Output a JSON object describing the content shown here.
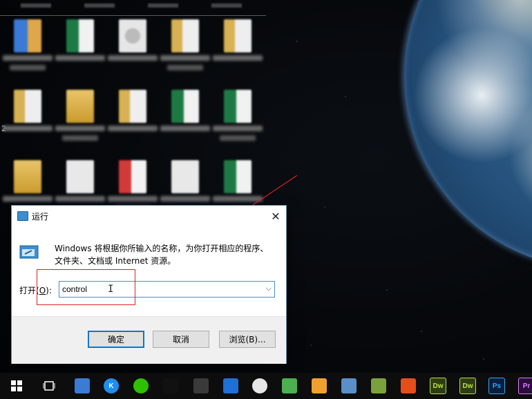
{
  "desktop": {
    "side_marker": "2",
    "icons": [
      {
        "type": "rar"
      },
      {
        "type": "excel"
      },
      {
        "type": "gear"
      },
      {
        "type": "folder-doc"
      },
      {
        "type": "folder-doc"
      },
      {
        "type": "folder-doc"
      },
      {
        "type": "folder"
      },
      {
        "type": "folder-doc"
      },
      {
        "type": "excel"
      },
      {
        "type": "excel"
      },
      {
        "type": "folder"
      },
      {
        "type": "file"
      },
      {
        "type": "pdf"
      },
      {
        "type": "file"
      },
      {
        "type": "excel"
      }
    ]
  },
  "run_dialog": {
    "title": "运行",
    "description": "Windows 将根据你所输入的名称，为你打开相应的程序、文件夹、文档或 Internet 资源。",
    "open_label_prefix": "打开(",
    "open_label_key": "O",
    "open_label_suffix": "):",
    "command_value": "control",
    "ok_label": "确定",
    "cancel_label": "取消",
    "browse_label": "浏览(B)..."
  },
  "annotation": {
    "color": "#e02020"
  },
  "taskbar": {
    "items": [
      {
        "name": "start-icon",
        "color": "#ffffff"
      },
      {
        "name": "task-view-icon",
        "color": "#ffffff"
      },
      {
        "name": "computer-icon",
        "color": "#3a7bd5"
      },
      {
        "name": "kugou-icon",
        "color": "#1e8ef0",
        "text": "K"
      },
      {
        "name": "wechat-icon",
        "color": "#2dc100"
      },
      {
        "name": "qq-icon",
        "color": "#111111"
      },
      {
        "name": "media-player-icon",
        "color": "#3a3a3a"
      },
      {
        "name": "back-arrow-app-icon",
        "color": "#1e6fd6"
      },
      {
        "name": "chat-bubble-icon",
        "color": "#e6e6e6"
      },
      {
        "name": "notes-app-icon",
        "color": "#4caf50"
      },
      {
        "name": "frame-app-icon",
        "color": "#f0a030"
      },
      {
        "name": "network-icon",
        "color": "#5a8fc8"
      },
      {
        "name": "tools-icon",
        "color": "#7aa13c"
      },
      {
        "name": "office-icon",
        "color": "#e74c1c"
      },
      {
        "name": "dreamweaver-icon",
        "color": "#2f3d12",
        "text": "Dw"
      },
      {
        "name": "dreamweaver-2-icon",
        "color": "#2f3d12",
        "text": "Dw"
      },
      {
        "name": "photoshop-icon",
        "color": "#0b1e3a",
        "text": "Ps"
      },
      {
        "name": "premiere-icon",
        "color": "#2a0f3a",
        "text": "Pr"
      }
    ]
  }
}
